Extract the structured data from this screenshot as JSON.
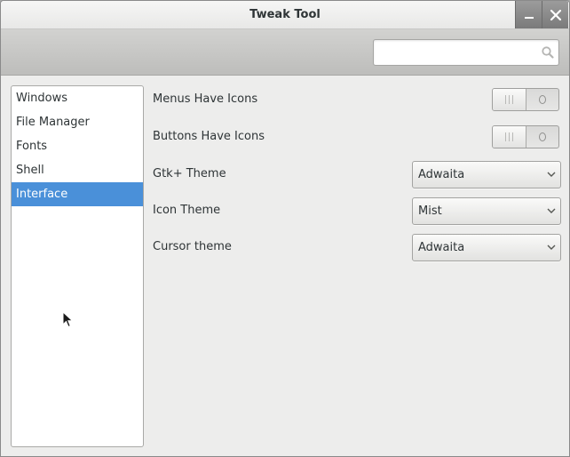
{
  "window": {
    "title": "Tweak Tool"
  },
  "titlebar": {
    "minimize_icon": "minimize-icon",
    "close_icon": "close-icon"
  },
  "search": {
    "value": "",
    "placeholder": "",
    "icon": "search-icon"
  },
  "sidebar": {
    "items": [
      {
        "label": "Windows",
        "selected": false
      },
      {
        "label": "File Manager",
        "selected": false
      },
      {
        "label": "Fonts",
        "selected": false
      },
      {
        "label": "Shell",
        "selected": false
      },
      {
        "label": "Interface",
        "selected": true
      }
    ]
  },
  "settings": {
    "menus_have_icons": {
      "label": "Menus Have Icons",
      "state": "off"
    },
    "buttons_have_icons": {
      "label": "Buttons Have Icons",
      "state": "off"
    },
    "gtk_theme": {
      "label": "Gtk+ Theme",
      "value": "Adwaita"
    },
    "icon_theme": {
      "label": "Icon Theme",
      "value": "Mist"
    },
    "cursor_theme": {
      "label": "Cursor theme",
      "value": "Adwaita"
    }
  },
  "colors": {
    "selection": "#4a90d9",
    "window_bg": "#ededec"
  }
}
